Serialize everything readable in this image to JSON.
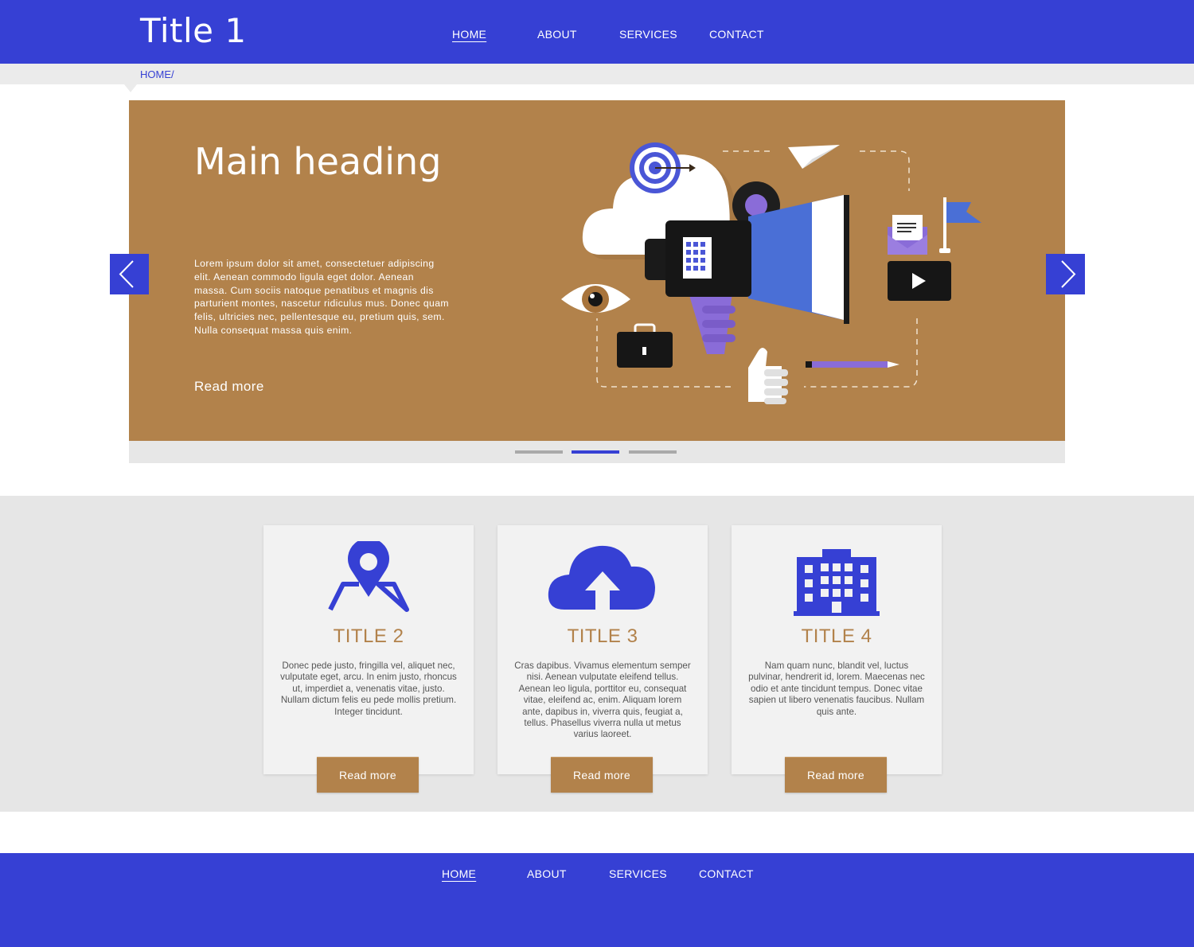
{
  "header": {
    "site_title": "Title 1",
    "nav": [
      {
        "label": "HOME",
        "active": true
      },
      {
        "label": "ABOUT",
        "active": false
      },
      {
        "label": "SERVICES",
        "active": false
      },
      {
        "label": "CONTACT",
        "active": false
      }
    ]
  },
  "breadcrumb": "HOME/",
  "hero": {
    "heading": "Main heading",
    "text": "Lorem ipsum dolor sit amet, consectetuer adipiscing elit. Aenean commodo ligula eget dolor. Aenean massa. Cum sociis natoque penatibus et magnis dis parturient montes, nascetur ridiculus mus. Donec quam felis, ultricies nec, pellentesque eu, pretium quis, sem. Nulla consequat massa quis enim.",
    "link": "Read more",
    "slides_total": 3,
    "active_slide": 2
  },
  "cards": [
    {
      "icon": "map-pin-icon",
      "title": "TITLE 2",
      "text": "Donec pede justo, fringilla vel, aliquet nec, vulputate eget, arcu. In enim justo, rhoncus ut, imperdiet a, venenatis vitae, justo. Nullam dictum felis eu pede mollis pretium. Integer tincidunt.",
      "button": "Read more"
    },
    {
      "icon": "cloud-upload-icon",
      "title": "TITLE 3",
      "text": "Cras dapibus. Vivamus elementum semper nisi. Aenean vulputate eleifend tellus. Aenean leo ligula, porttitor eu, consequat vitae, eleifend ac, enim. Aliquam lorem ante, dapibus in, viverra quis, feugiat a, tellus. Phasellus viverra nulla ut metus varius laoreet.",
      "button": "Read more"
    },
    {
      "icon": "building-icon",
      "title": "TITLE 4",
      "text": "Nam quam nunc, blandit vel, luctus pulvinar, hendrerit id, lorem. Maecenas nec odio et ante tincidunt tempus. Donec vitae sapien ut libero venenatis faucibus. Nullam quis ante.",
      "button": "Read more"
    }
  ],
  "footer": {
    "nav": [
      {
        "label": "HOME",
        "active": true
      },
      {
        "label": "ABOUT",
        "active": false
      },
      {
        "label": "SERVICES",
        "active": false
      },
      {
        "label": "CONTACT",
        "active": false
      }
    ]
  },
  "colors": {
    "primary": "#3640d4",
    "accent": "#b2824b",
    "panel": "#e6e6e6",
    "card": "#f2f2f2"
  }
}
